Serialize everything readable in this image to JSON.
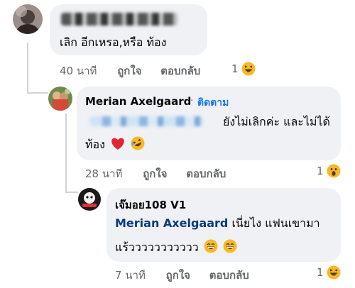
{
  "comment1": {
    "text": "เลิก อีกเหรอ,หรือ ท้อง",
    "time": "40 นาที",
    "like_label": "ถูกใจ",
    "reply_label": "ตอบกลับ",
    "reaction_count": "1"
  },
  "comment2": {
    "author": "Merian Axelgaard",
    "follow_label": "ติดตาม",
    "text_line1": "ยังไม่เลิกค่ะ และไม่ได้",
    "text_line2": "ท้อง",
    "time": "28 นาที",
    "like_label": "ถูกใจ",
    "reply_label": "ตอบกลับ",
    "reaction_count": "1"
  },
  "comment3": {
    "author": "เจ๊มอย108 V1",
    "mention": "Merian Axelgaard",
    "text_line1": "เนี่ยไง แฟนเขามา",
    "text_line2": "แร้ววววววววววว",
    "time": "7 นาที",
    "like_label": "ถูกใจ",
    "reply_label": "ตอบกลับ",
    "reaction_count": "1"
  },
  "colors": {
    "bubble": "#eff1f4",
    "link": "#1877f2",
    "mention": "#0b3a82",
    "meta": "#65676b"
  }
}
